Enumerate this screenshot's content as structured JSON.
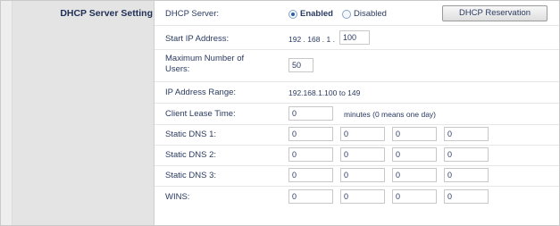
{
  "section": {
    "title": "DHCP Server Setting"
  },
  "dhcp_server": {
    "label": "DHCP Server:",
    "enabled_label": "Enabled",
    "disabled_label": "Disabled",
    "selected": "Enabled",
    "reservation_button": "DHCP Reservation"
  },
  "start_ip": {
    "label": "Start IP Address:",
    "prefix": "192 . 168 . 1 .",
    "last_octet": "100"
  },
  "max_users": {
    "label": "Maximum Number of Users:",
    "value": "50"
  },
  "ip_range": {
    "label": "IP Address Range:",
    "value": "192.168.1.100 to 149"
  },
  "lease_time": {
    "label": "Client Lease Time:",
    "value": "0",
    "suffix": "minutes (0 means one day)"
  },
  "static_dns_1": {
    "label": "Static DNS 1:",
    "octets": [
      "0",
      "0",
      "0",
      "0"
    ]
  },
  "static_dns_2": {
    "label": "Static DNS 2:",
    "octets": [
      "0",
      "0",
      "0",
      "0"
    ]
  },
  "static_dns_3": {
    "label": "Static DNS 3:",
    "octets": [
      "0",
      "0",
      "0",
      "0"
    ]
  },
  "wins": {
    "label": "WINS:",
    "octets": [
      "0",
      "0",
      "0",
      "0"
    ]
  }
}
